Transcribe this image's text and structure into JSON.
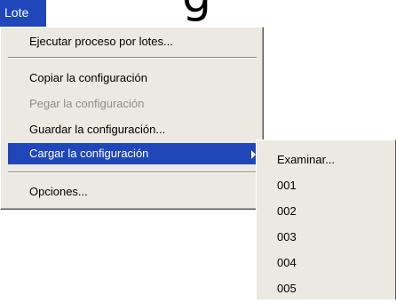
{
  "menubar": {
    "lote_label": "Lote"
  },
  "menu": {
    "items": [
      {
        "label": "Ejecutar proceso por lotes...",
        "enabled": true
      },
      {
        "label": "Copiar la configuración",
        "enabled": true
      },
      {
        "label": "Pegar la configuración",
        "enabled": false
      },
      {
        "label": "Guardar la configuración...",
        "enabled": true
      },
      {
        "label": "Cargar la configuración",
        "enabled": true,
        "highlighted": true,
        "has_submenu": true
      },
      {
        "label": "Opciones...",
        "enabled": true
      }
    ]
  },
  "submenu": {
    "items": [
      "Examinar...",
      "001",
      "002",
      "003",
      "004",
      "005"
    ]
  },
  "background": {
    "partial_title": "g"
  },
  "colors": {
    "highlight": "#1f47b9",
    "menu_bg": "#ebe9e2",
    "disabled_text": "#8d8d8d"
  }
}
